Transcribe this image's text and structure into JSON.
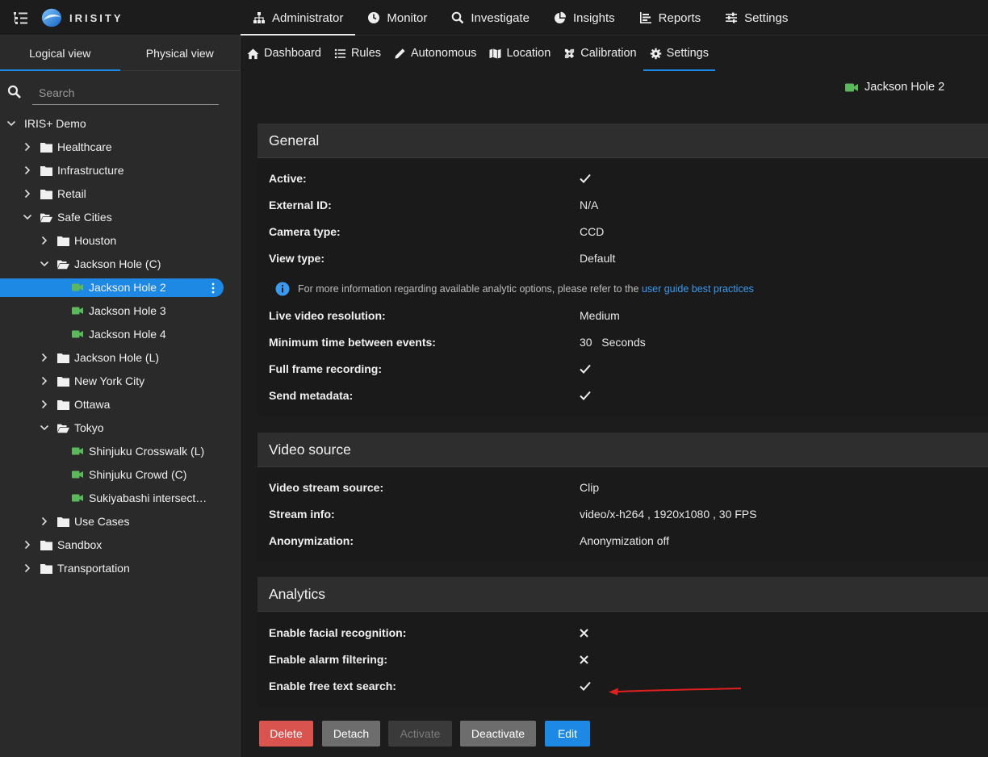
{
  "app": {
    "brand": "IRISITY",
    "top_nav": [
      {
        "label": "Administrator",
        "icon": "sitemap-icon"
      },
      {
        "label": "Monitor",
        "icon": "clock-icon"
      },
      {
        "label": "Investigate",
        "icon": "search-icon"
      },
      {
        "label": "Insights",
        "icon": "pie-chart-icon"
      },
      {
        "label": "Reports",
        "icon": "bar-chart-icon"
      },
      {
        "label": "Settings",
        "icon": "sliders-icon"
      }
    ],
    "active_top_nav": "Administrator"
  },
  "sidebar": {
    "tabs": [
      "Logical view",
      "Physical view"
    ],
    "active_tab": "Logical view",
    "search_placeholder": "Search",
    "tree": [
      {
        "label": "IRIS+ Demo",
        "type": "root",
        "expanded": true
      },
      {
        "label": "Healthcare",
        "type": "folder"
      },
      {
        "label": "Infrastructure",
        "type": "folder"
      },
      {
        "label": "Retail",
        "type": "folder"
      },
      {
        "label": "Safe Cities",
        "type": "folder-open",
        "expanded": true
      },
      {
        "label": "Houston",
        "type": "folder"
      },
      {
        "label": "Jackson Hole (C)",
        "type": "folder-open",
        "expanded": true
      },
      {
        "label": "Jackson Hole 2",
        "type": "camera",
        "selected": true
      },
      {
        "label": "Jackson Hole 3",
        "type": "camera"
      },
      {
        "label": "Jackson Hole 4",
        "type": "camera"
      },
      {
        "label": "Jackson Hole (L)",
        "type": "folder"
      },
      {
        "label": "New York City",
        "type": "folder"
      },
      {
        "label": "Ottawa",
        "type": "folder"
      },
      {
        "label": "Tokyo",
        "type": "folder-open",
        "expanded": true
      },
      {
        "label": "Shinjuku Crosswalk (L)",
        "type": "camera"
      },
      {
        "label": "Shinjuku Crowd (C)",
        "type": "camera"
      },
      {
        "label": "Sukiyabashi intersect…",
        "type": "camera"
      },
      {
        "label": "Use Cases",
        "type": "folder"
      },
      {
        "label": "Sandbox",
        "type": "folder"
      },
      {
        "label": "Transportation",
        "type": "folder"
      }
    ]
  },
  "sub_nav": [
    {
      "label": "Dashboard",
      "icon": "home-icon"
    },
    {
      "label": "Rules",
      "icon": "list-icon"
    },
    {
      "label": "Autonomous",
      "icon": "pencil-icon"
    },
    {
      "label": "Location",
      "icon": "map-icon"
    },
    {
      "label": "Calibration",
      "icon": "tools-icon"
    },
    {
      "label": "Settings",
      "icon": "gear-icon"
    }
  ],
  "active_sub_nav": "Settings",
  "camera_title": "Jackson Hole 2",
  "general": {
    "title": "General",
    "rows": [
      {
        "label": "Active:",
        "value": "check"
      },
      {
        "label": "External ID:",
        "value": "N/A"
      },
      {
        "label": "Camera type:",
        "value": "CCD"
      },
      {
        "label": "View type:",
        "value": "Default"
      }
    ],
    "info_text": "For more information regarding available analytic options, please refer to the",
    "info_link": "user guide best practices",
    "rows2": [
      {
        "label": "Live video resolution:",
        "value": "Medium"
      },
      {
        "label": "Minimum time between events:",
        "value_num": "30",
        "value_unit": "Seconds"
      },
      {
        "label": "Full frame recording:",
        "value": "check"
      },
      {
        "label": "Send metadata:",
        "value": "check"
      }
    ]
  },
  "video_source": {
    "title": "Video source",
    "rows": [
      {
        "label": "Video stream source:",
        "value": "Clip"
      },
      {
        "label": "Stream info:",
        "value": "video/x-h264 , 1920x1080 , 30 FPS"
      },
      {
        "label": "Anonymization:",
        "value": "Anonymization off"
      }
    ]
  },
  "analytics": {
    "title": "Analytics",
    "rows": [
      {
        "label": "Enable facial recognition:",
        "value": "cross"
      },
      {
        "label": "Enable alarm filtering:",
        "value": "cross"
      },
      {
        "label": "Enable free text search:",
        "value": "check"
      }
    ]
  },
  "buttons": {
    "delete": "Delete",
    "detach": "Detach",
    "activate": "Activate",
    "deactivate": "Deactivate",
    "edit": "Edit"
  },
  "colors": {
    "accent": "#1e88e5",
    "camera": "#5cb85c",
    "danger": "#d9534f",
    "annotation_arrow": "#e02020"
  }
}
